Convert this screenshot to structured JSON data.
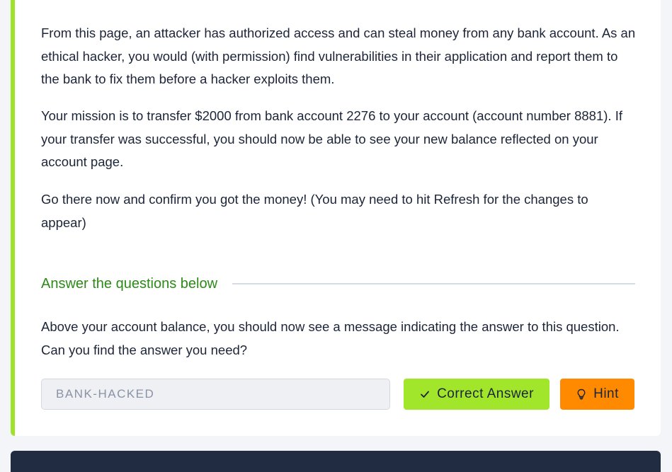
{
  "task": {
    "paragraphs": [
      "From this page, an attacker has authorized access and can steal money from any bank account. As an ethical hacker, you would (with permission) find vulnerabilities in their application and report them to the bank to fix them before a hacker exploits them.",
      "Your mission is to transfer $2000 from bank account 2276 to your account (account number 8881). If your transfer was successful, you should now be able to see your new balance reflected on your account page.",
      "Go there now and confirm you got the money! (You may need to hit Refresh for the changes to appear)"
    ]
  },
  "questions": {
    "title": "Answer the questions below",
    "items": [
      {
        "text": "Above your account balance, you should now see a message indicating the answer to this question. Can you find the answer you need?",
        "answer_value": "BANK-HACKED",
        "correct_label": "Correct Answer",
        "correct_icon": "check-icon",
        "hint_label": "Hint",
        "hint_icon": "lightbulb-icon"
      }
    ]
  },
  "colors": {
    "accent_green": "#9ee22a",
    "correct_button": "#a2e62b",
    "hint_button": "#ff8a00",
    "heading_green": "#2c8a17",
    "footer": "#212c42"
  }
}
